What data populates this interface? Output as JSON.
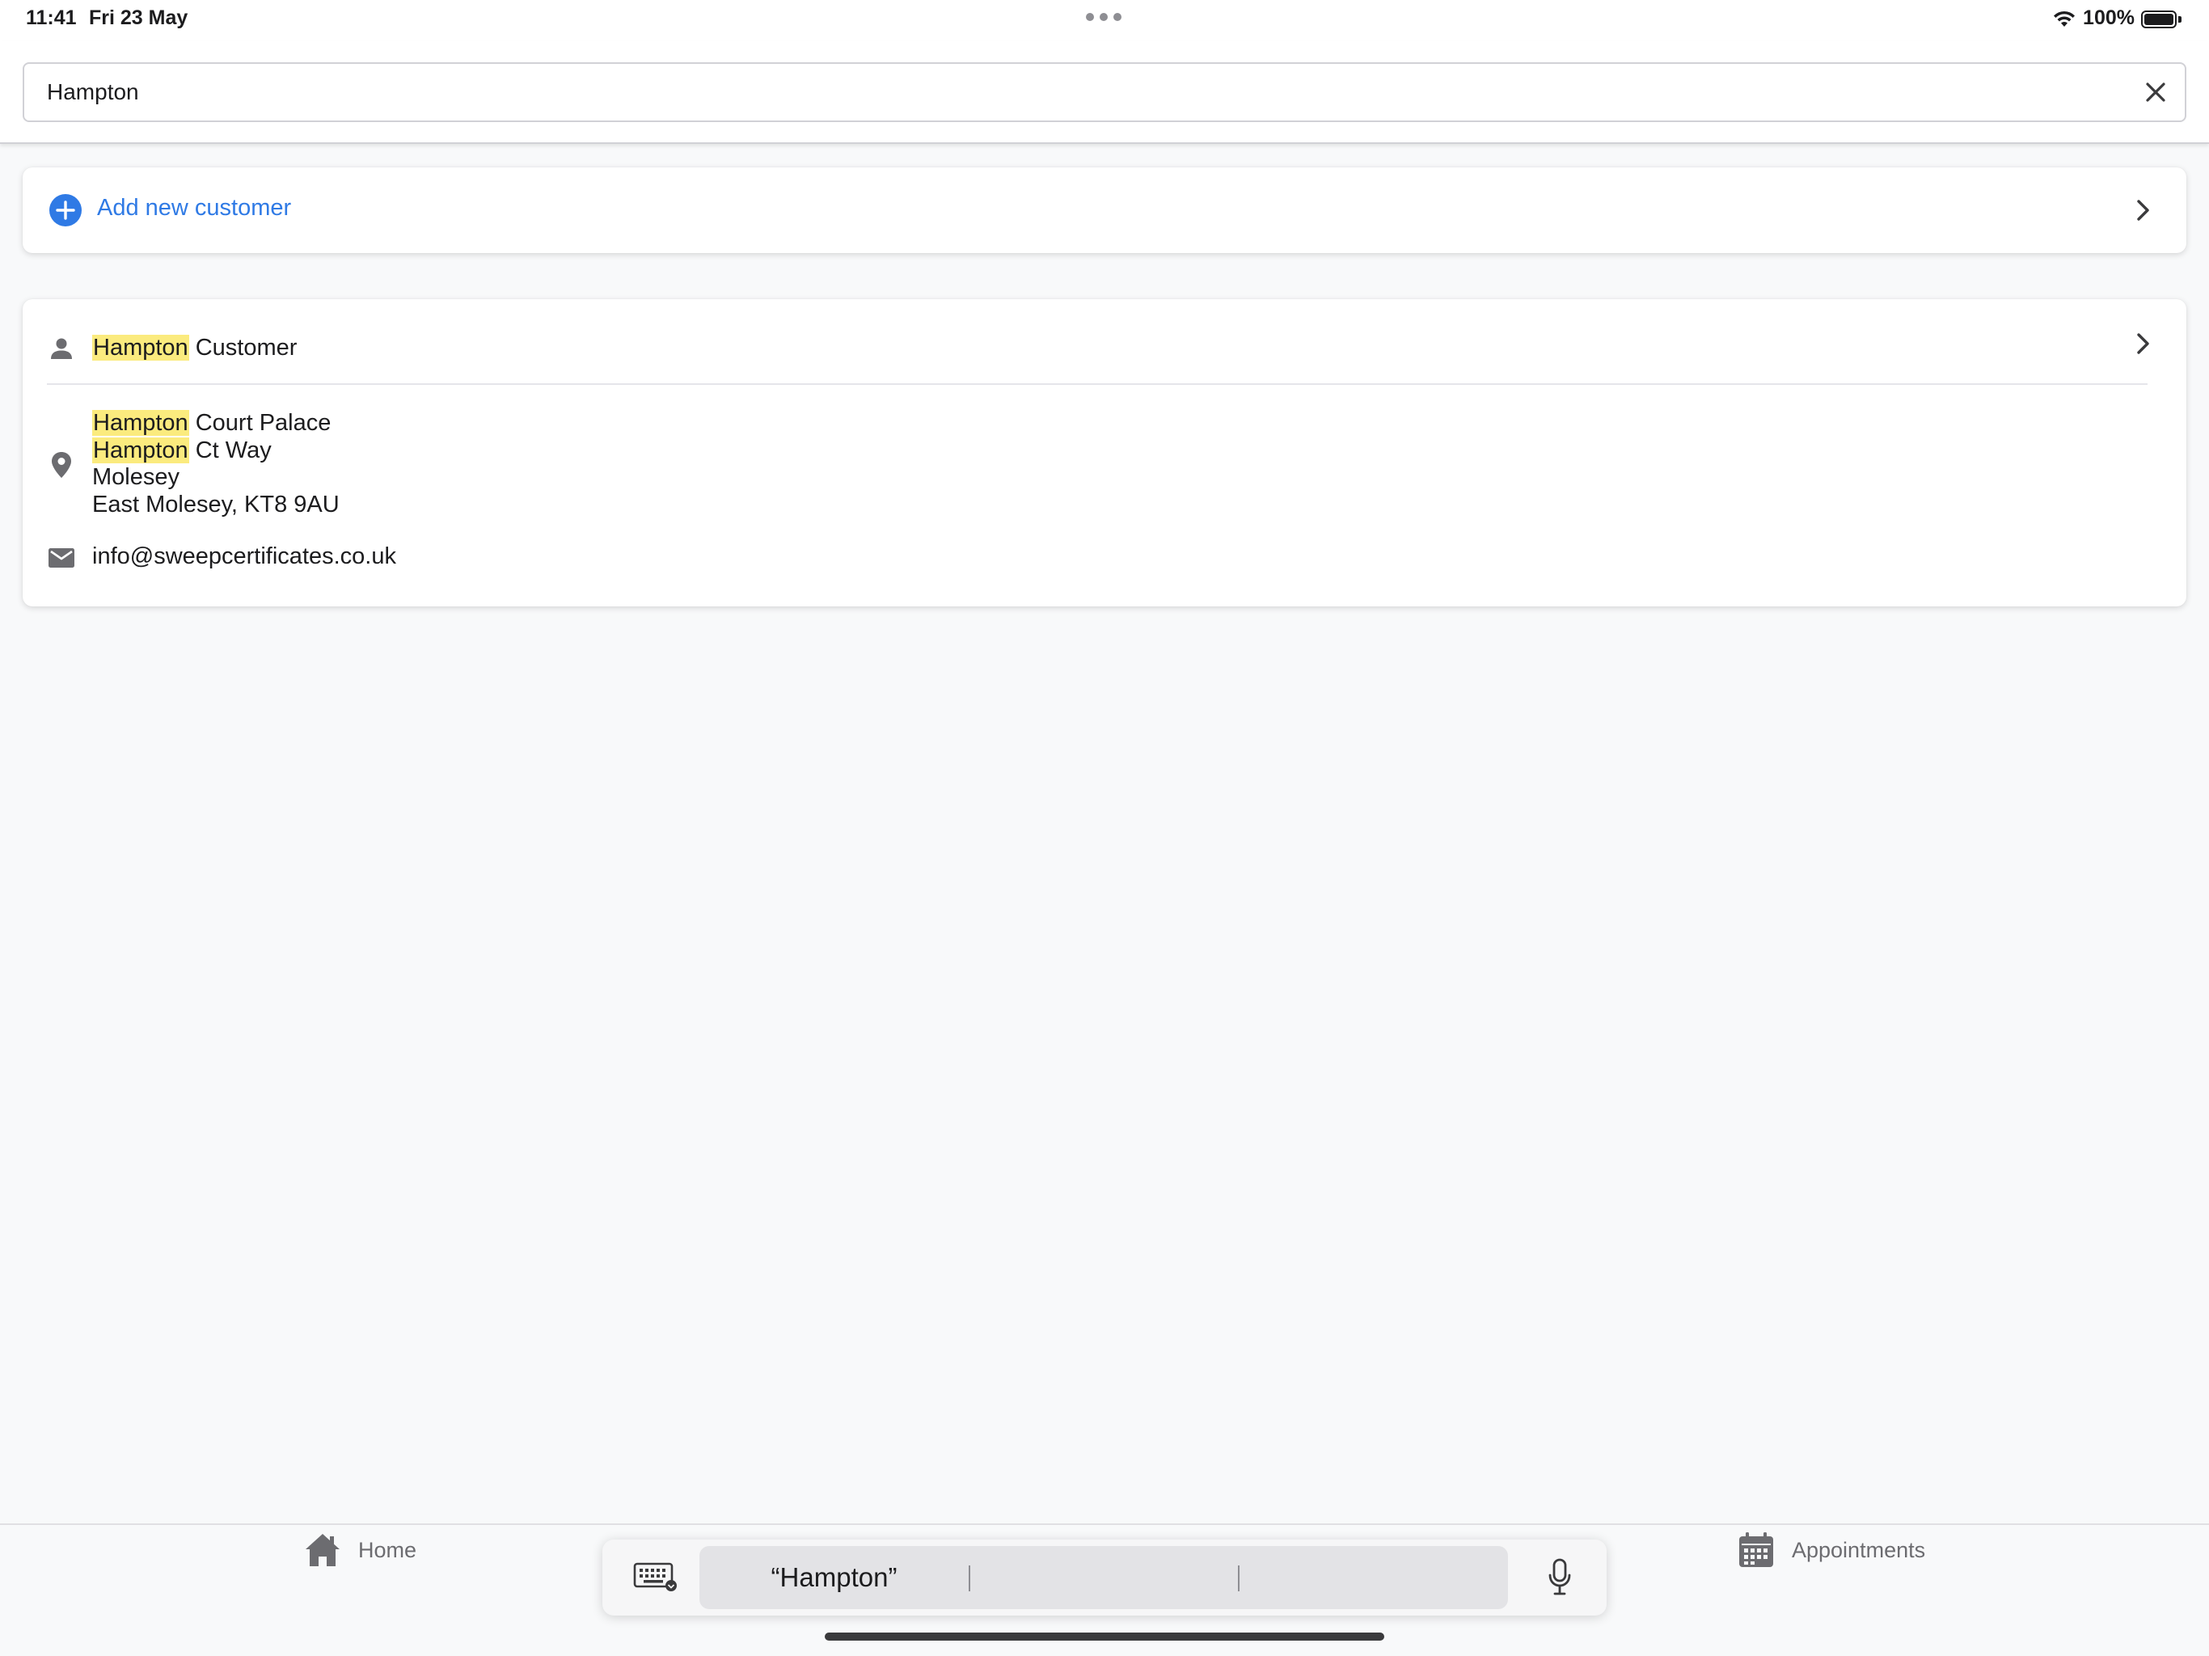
{
  "status_bar": {
    "time": "11:41",
    "date": "Fri 23 May",
    "battery": "100%",
    "icons": [
      "wifi-icon",
      "battery-icon"
    ]
  },
  "search": {
    "value": "Hampton",
    "placeholder": "",
    "clear_icon": "close-icon"
  },
  "add_customer": {
    "label": "Add new customer",
    "icon": "plus-circle-icon",
    "accent": "#2f7ae5"
  },
  "results": [
    {
      "name_highlight": "Hampton",
      "name_rest": " Customer",
      "address": [
        {
          "highlight": "Hampton",
          "rest": " Court Palace"
        },
        {
          "highlight": "Hampton",
          "rest": " Ct Way"
        },
        {
          "highlight": "",
          "rest": "Molesey"
        },
        {
          "highlight": "",
          "rest": "East Molesey, KT8 9AU"
        }
      ],
      "email": "info@sweepcertificates.co.uk"
    }
  ],
  "highlight_color": "#fbeb7e",
  "tab_bar": {
    "home_label": "Home",
    "appointments_label": "Appointments"
  },
  "keyboard_bar": {
    "suggestions": [
      "“Hampton”",
      "",
      ""
    ]
  }
}
